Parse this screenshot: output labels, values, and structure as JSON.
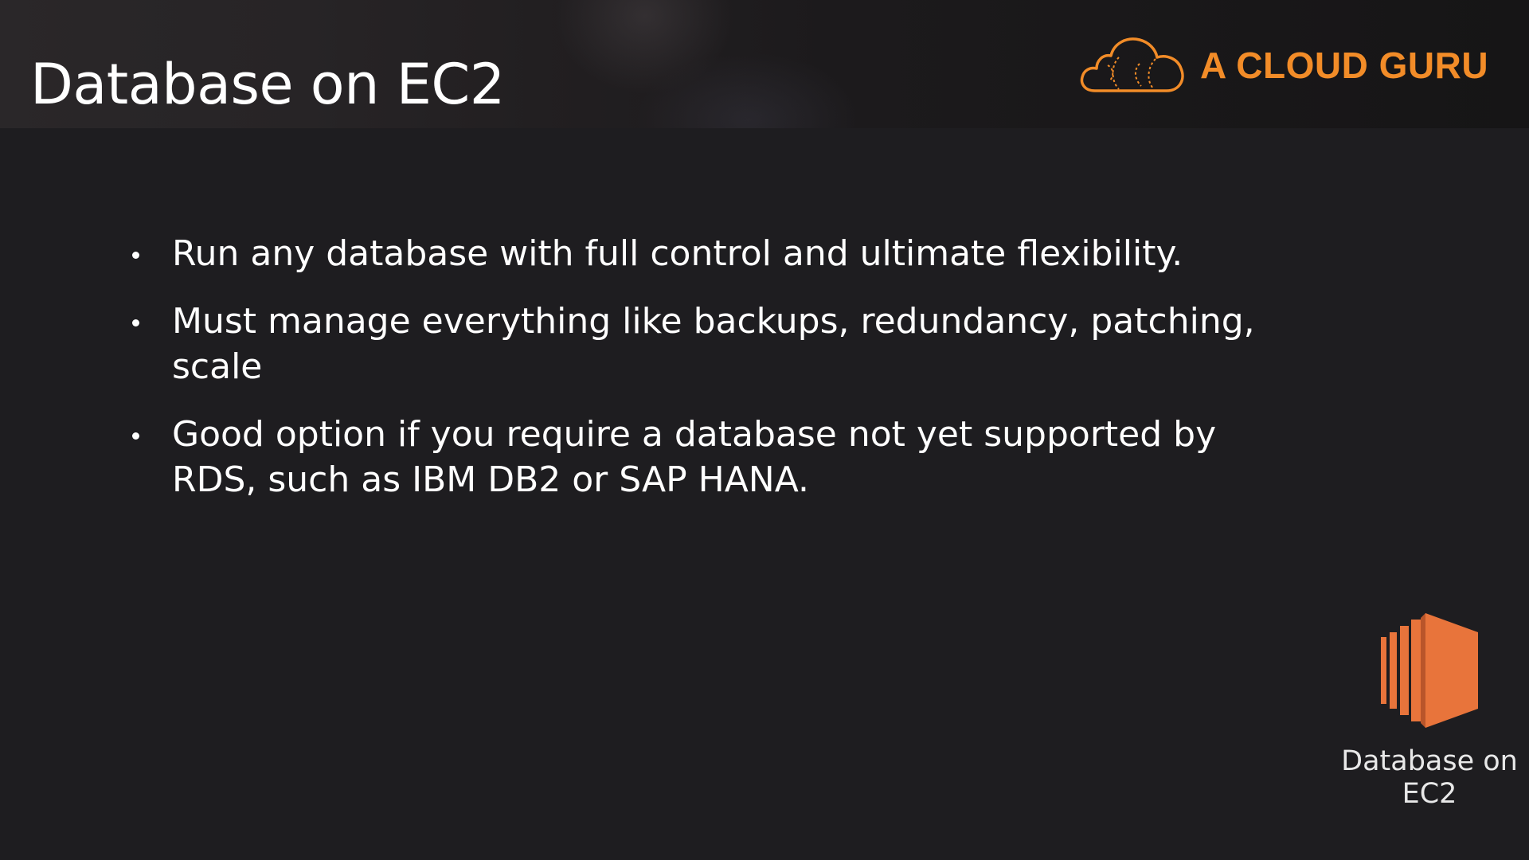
{
  "slide": {
    "title": "Database on EC2"
  },
  "logo": {
    "text": "A CLOUD GURU",
    "icon": "cloud-icon",
    "color": "#f28c28"
  },
  "bullets": [
    {
      "text": "Run any database with full control and ultimate flexibility."
    },
    {
      "text": "Must manage everything like backups, redundancy, patching, scale"
    },
    {
      "text": "Good option if you require a database not yet supported by RDS, such as IBM DB2 or SAP HANA."
    }
  ],
  "service": {
    "icon": "ec2-icon",
    "label": "Database on EC2",
    "color": "#e8743b"
  },
  "colors": {
    "background": "#1e1d20",
    "text": "#ffffff",
    "accent": "#f28c28"
  }
}
